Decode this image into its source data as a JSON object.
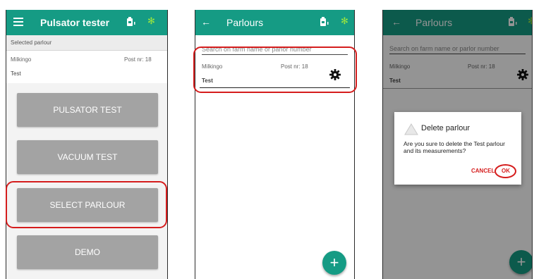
{
  "colors": {
    "appbar": "#159b84",
    "bluetooth": "#9be63f",
    "button_gray": "#a3a3a3",
    "highlight_red": "#d51d1d",
    "fab": "#159b84"
  },
  "screen1": {
    "title": "Pulsator tester",
    "icons": [
      "menu-icon",
      "battery-icon",
      "bluetooth-icon"
    ],
    "selected_parlour_label": "Selected parlour",
    "parlour": {
      "farm": "Milkingo",
      "post": "Post nr: 18",
      "name": "Test"
    },
    "buttons": {
      "pulsator_test": "PULSATOR TEST",
      "vacuum_test": "VACUUM TEST",
      "select_parlour": "SELECT PARLOUR",
      "demo": "DEMO"
    }
  },
  "screen2": {
    "title": "Parlours",
    "icons": [
      "back-arrow-icon",
      "battery-icon",
      "bluetooth-icon",
      "gear-icon",
      "add-icon"
    ],
    "search_placeholder": "Search on farm name or parlor number",
    "parlour": {
      "farm": "Milkingo",
      "post": "Post nr: 18",
      "name": "Test"
    },
    "fab_label": "+"
  },
  "screen3": {
    "title": "Parlours",
    "search_placeholder": "Search on farm name or parlor number",
    "parlour": {
      "farm": "Milkingo",
      "post": "Post nr: 18",
      "name": "Test"
    },
    "fab_label": "+",
    "dialog": {
      "title": "Delete parlour",
      "message": "Are you sure to delete the Test parlour and its measurements?",
      "cancel": "CANCEL",
      "ok": "OK",
      "icon": "warning-icon"
    }
  }
}
